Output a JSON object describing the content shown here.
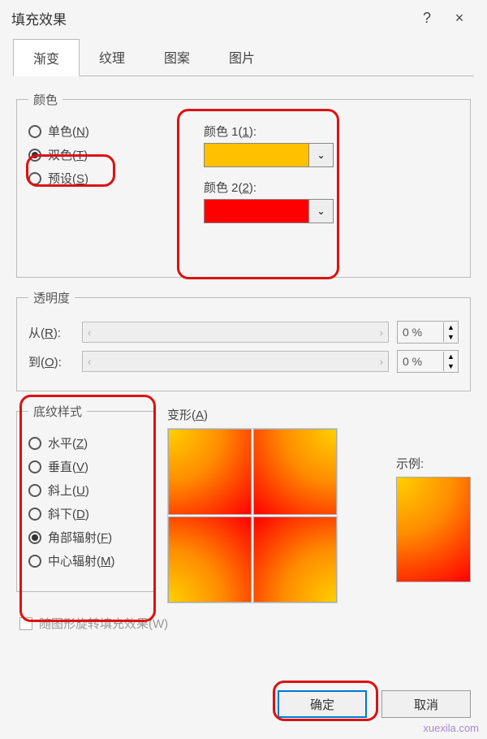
{
  "titlebar": {
    "title": "填充效果",
    "help": "?",
    "close": "×"
  },
  "tabs": {
    "t0": "渐变",
    "t1": "纹理",
    "t2": "图案",
    "t3": "图片"
  },
  "colors": {
    "legend": "颜色",
    "r_single": "单色(",
    "r_single_k": "N",
    "r_single_e": ")",
    "r_two": "双色(",
    "r_two_k": "T",
    "r_two_e": ")",
    "r_preset": "预设(",
    "r_preset_k": "S",
    "r_preset_e": ")",
    "c1_label": "颜色 1(",
    "c1_k": "1",
    "c1_e": "):",
    "c2_label": "颜色 2(",
    "c2_k": "2",
    "c2_e": "):",
    "c1_hex": "#ffc000",
    "c2_hex": "#ff0000"
  },
  "trans": {
    "legend": "透明度",
    "from": "从(",
    "from_k": "R",
    "from_e": "):",
    "to": "到(",
    "to_k": "O",
    "to_e": "):",
    "from_val": "0 %",
    "to_val": "0 %",
    "lt": "‹",
    "gt": "›"
  },
  "styles": {
    "legend": "底纹样式",
    "r_h": "水平(",
    "r_h_k": "Z",
    "r_h_e": ")",
    "r_v": "垂直(",
    "r_v_k": "V",
    "r_v_e": ")",
    "r_du": "斜上(",
    "r_du_k": "U",
    "r_du_e": ")",
    "r_dd": "斜下(",
    "r_dd_k": "D",
    "r_dd_e": ")",
    "r_corner": "角部辐射(",
    "r_corner_k": "F",
    "r_corner_e": ")",
    "r_center": "中心辐射(",
    "r_center_k": "M",
    "r_center_e": ")"
  },
  "variants": {
    "label": "变形(",
    "label_k": "A",
    "label_e": ")"
  },
  "sample": {
    "label": "示例:"
  },
  "rotate": {
    "label": "随图形旋转填充效果(W)"
  },
  "footer": {
    "ok": "确定",
    "cancel": "取消"
  },
  "watermark": "xuexila.com",
  "chevron": "⌄",
  "up": "▲",
  "down": "▼"
}
